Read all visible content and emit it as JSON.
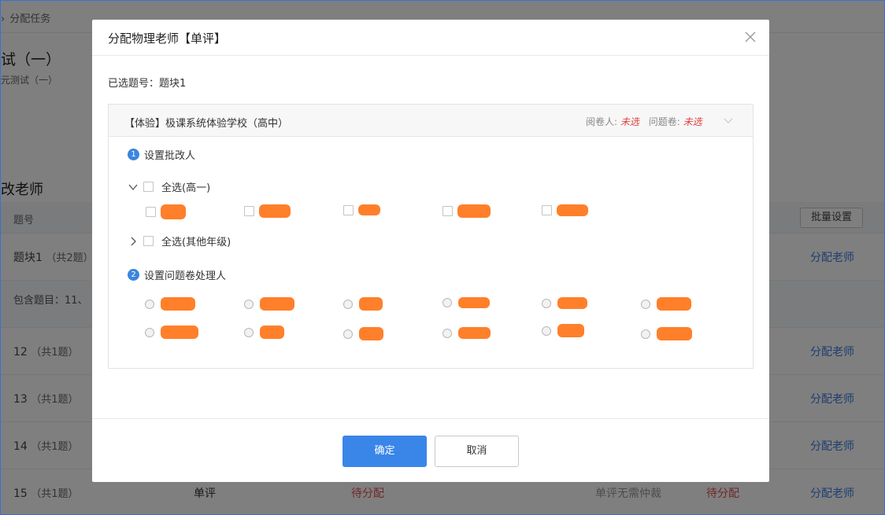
{
  "background": {
    "breadcrumb_sep": "›",
    "breadcrumb": "分配任务",
    "exam_title": "试（一）",
    "exam_sub": "元测试（一）",
    "section_title": "改老师",
    "table_header_no": "题号",
    "batch_button": "批量设置",
    "rows": [
      {
        "no": "题块1",
        "cnt": "（共2题）",
        "assign": "分配老师"
      },
      {
        "sub": "包含题目：11、"
      },
      {
        "no": "12",
        "cnt": "（共1题）",
        "assign": "分配老师"
      },
      {
        "no": "13",
        "cnt": "（共1题）",
        "assign": "分配老师"
      },
      {
        "no": "14",
        "cnt": "（共1题）",
        "assign": "分配老师"
      },
      {
        "no": "15",
        "cnt": "（共1题）",
        "type": "单评",
        "pending": "待分配",
        "noarb": "单评无需仲裁",
        "pending2": "待分配",
        "assign": "分配老师"
      }
    ]
  },
  "modal": {
    "title": "分配物理老师【单评】",
    "selected_label": "已选题号：题块1",
    "school": "【体验】极课系统体验学校（高中）",
    "reader_label": "阅卷人:",
    "reader_value": "未选",
    "issue_label": "问题卷:",
    "issue_value": "未选",
    "step1_num": "1",
    "step1_label": "设置批改人",
    "group1_label": "全选(高一)",
    "group2_label": "全选(其他年级)",
    "step2_num": "2",
    "step2_label": "设置问题卷处理人",
    "ok_label": "确定",
    "cancel_label": "取消"
  },
  "colors": {
    "primary": "#3a86e8",
    "link": "#3a7de0",
    "danger": "#e04040",
    "redaction": "#ff7f2a"
  }
}
